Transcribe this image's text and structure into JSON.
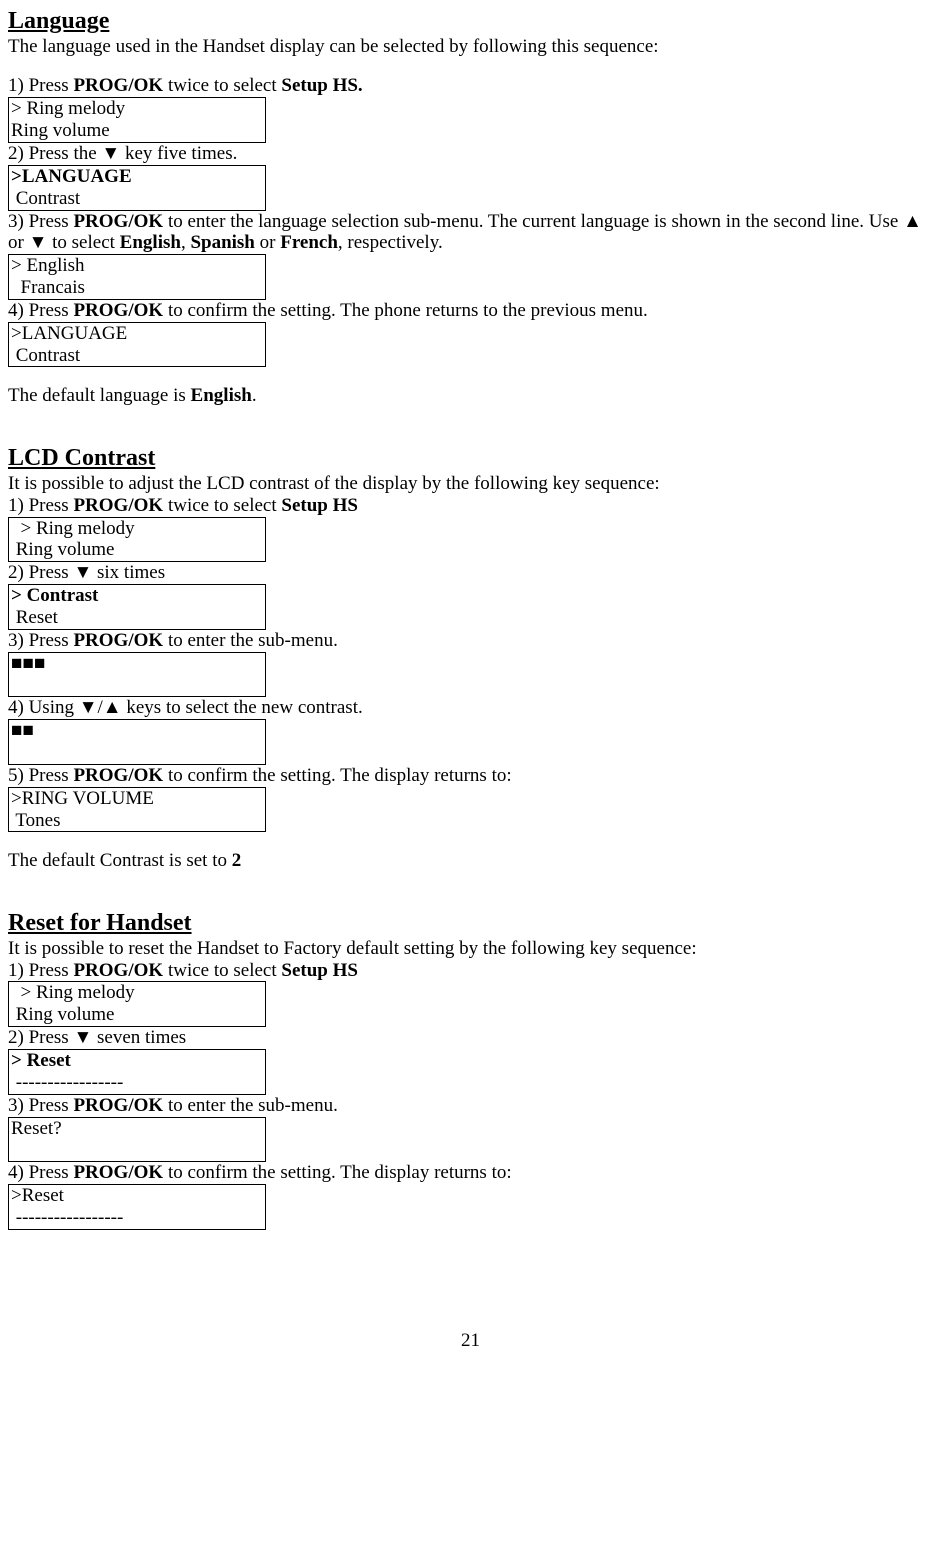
{
  "pageNumber": "21",
  "s1": {
    "title": "Language",
    "intro": "The language used in the Handset display can be selected by following this sequence:",
    "step1": {
      "pre": "1) Press ",
      "b1": "PROG/OK",
      "mid": " twice to select ",
      "b2": "Setup HS."
    },
    "box1": {
      "l1": "> Ring melody",
      "l2": "Ring volume"
    },
    "step2": "2) Press the ▼ key five times.",
    "box2": {
      "l1": ">LANGUAGE",
      "l2": " Contrast"
    },
    "step3": {
      "pre": "3) Press ",
      "b1": "PROG/OK",
      "mid1": " to enter the language selection sub-menu. The current language is shown in the second line. Use ▲ or ▼ to select ",
      "b2": "English",
      "mid2": ", ",
      "b3": "Spanish",
      "mid3": " or ",
      "b4": "French",
      "tail": ", respectively."
    },
    "box3": {
      "l1": "> English",
      "l2": "  Francais"
    },
    "step4": {
      "pre": "4) Press ",
      "b1": "PROG/OK",
      "mid": " to confirm the setting. The phone returns to the previous menu."
    },
    "box4": {
      "l1": ">LANGUAGE",
      "l2": " Contrast"
    },
    "default": {
      "pre": "The default language is ",
      "b1": "English",
      "tail": "."
    }
  },
  "s2": {
    "title": "LCD Contrast",
    "intro": "It is possible to adjust the LCD contrast of the display by the following key sequence:",
    "step1": {
      "pre": "1) Press ",
      "b1": "PROG/OK",
      "mid": " twice to select ",
      "b2": "Setup HS"
    },
    "box1": {
      "l1": "  > Ring melody",
      "l2": " Ring volume"
    },
    "step2": "2) Press ▼ six times",
    "box2": {
      "l1": "> Contrast",
      "l2": " Reset"
    },
    "step3": {
      "pre": "3) Press ",
      "b1": "PROG/OK",
      "mid": " to enter the sub-menu."
    },
    "box3": {
      "l1": "■■■",
      "l2": " "
    },
    "step4": "4) Using ▼/▲ keys to select the new contrast.",
    "box4": {
      "l1": "■■",
      "l2": " "
    },
    "step5": {
      "pre": "5) Press ",
      "b1": "PROG/OK",
      "mid": " to confirm the setting.  The display returns to:"
    },
    "box5": {
      "l1": ">RING VOLUME",
      "l2": " Tones"
    },
    "default": {
      "pre": "The default Contrast is set to ",
      "b1": "2"
    }
  },
  "s3": {
    "title": "Reset for Handset",
    "intro": "It is possible to reset the Handset to Factory default setting by the following key sequence:",
    "step1": {
      "pre": "1) Press ",
      "b1": "PROG/OK",
      "mid": " twice to select ",
      "b2": "Setup HS"
    },
    "box1": {
      "l1": "  > Ring melody",
      "l2": " Ring volume"
    },
    "step2": "2) Press ▼ seven times",
    "box2": {
      "l1": "> Reset",
      "l2": " -----------------"
    },
    "step3": {
      "pre": "3) Press ",
      "b1": "PROG/OK",
      "mid": " to enter the sub-menu."
    },
    "box3": {
      "l1": "Reset?",
      "l2": " "
    },
    "step4": {
      "pre": "4) Press ",
      "b1": "PROG/OK",
      "mid": " to confirm the setting.  The display returns to:"
    },
    "box4": {
      "l1": ">Reset",
      "l2": " -----------------"
    }
  }
}
